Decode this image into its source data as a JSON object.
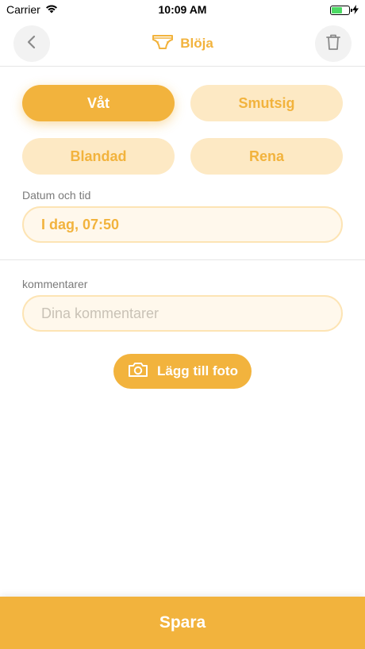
{
  "status_bar": {
    "carrier": "Carrier",
    "time": "10:09 AM"
  },
  "header": {
    "title": "Blöja",
    "back_icon": "chevron-left-icon",
    "delete_icon": "trash-icon",
    "title_icon": "diaper-icon"
  },
  "types": [
    {
      "label": "Våt",
      "selected": true
    },
    {
      "label": "Smutsig",
      "selected": false
    },
    {
      "label": "Blandad",
      "selected": false
    },
    {
      "label": "Rena",
      "selected": false
    }
  ],
  "datetime": {
    "label": "Datum och tid",
    "value": "I dag, 07:50"
  },
  "comments": {
    "label": "kommentarer",
    "placeholder": "Dina kommentarer",
    "value": ""
  },
  "photo_button": {
    "label": "Lägg till foto",
    "icon": "camera-icon"
  },
  "save_button": {
    "label": "Spara"
  },
  "colors": {
    "accent": "#f2b33d",
    "accent_light": "#fde9c4",
    "field_bg": "#fff8ec",
    "battery_green": "#4cd964"
  }
}
